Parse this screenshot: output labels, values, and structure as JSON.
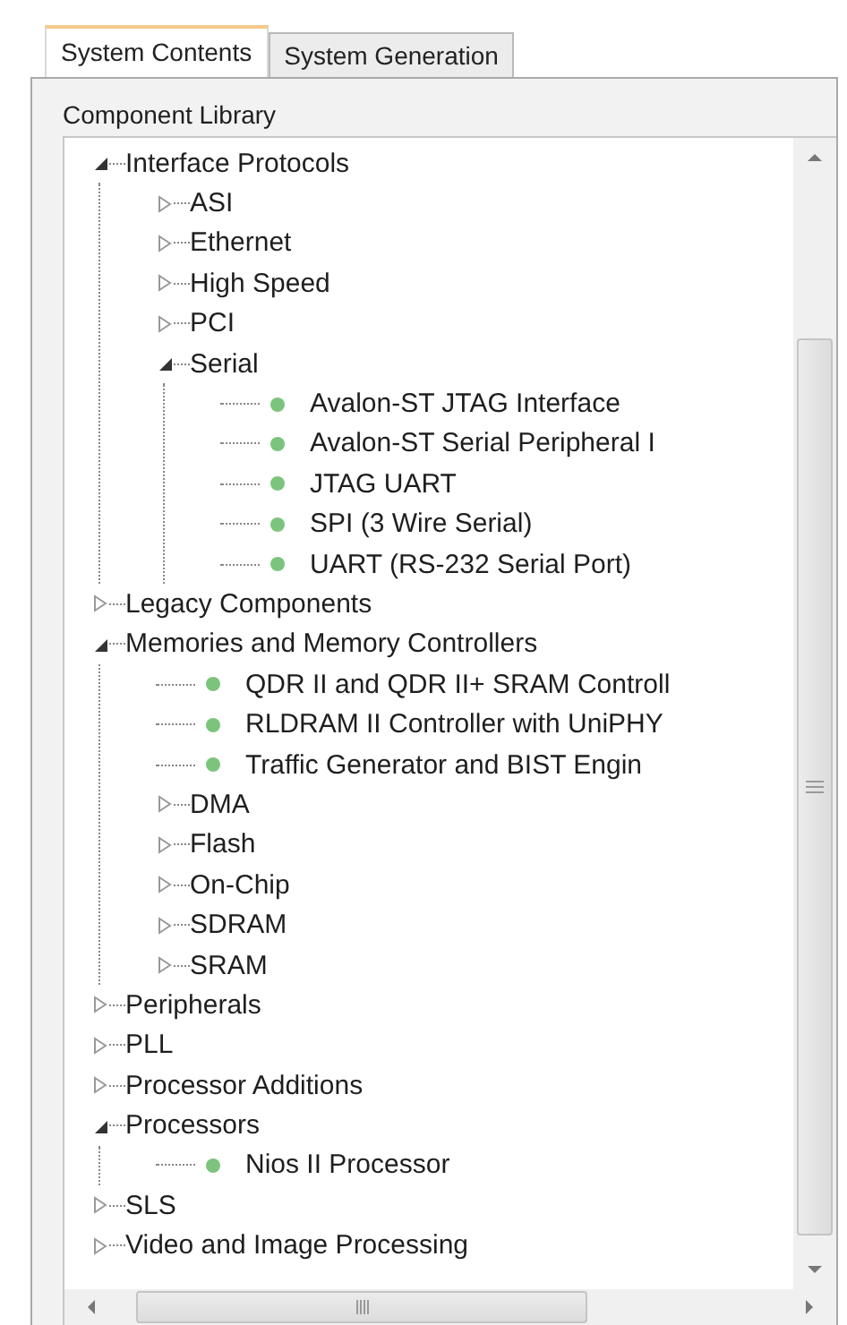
{
  "tabs": [
    {
      "label": "System Contents",
      "selected": true
    },
    {
      "label": "System Generation",
      "selected": false
    }
  ],
  "panel": {
    "title": "Component Library"
  },
  "tree": [
    {
      "kind": "folder",
      "label": "Interface Protocols",
      "expanded": true,
      "children": [
        {
          "kind": "folder",
          "label": "ASI",
          "expanded": false
        },
        {
          "kind": "folder",
          "label": "Ethernet",
          "expanded": false
        },
        {
          "kind": "folder",
          "label": "High Speed",
          "expanded": false
        },
        {
          "kind": "folder",
          "label": "PCI",
          "expanded": false
        },
        {
          "kind": "folder",
          "label": "Serial",
          "expanded": true,
          "children": [
            {
              "kind": "component",
              "label": "Avalon-ST JTAG Interface"
            },
            {
              "kind": "component",
              "label": "Avalon-ST Serial Peripheral I"
            },
            {
              "kind": "component",
              "label": "JTAG UART"
            },
            {
              "kind": "component",
              "label": "SPI (3 Wire Serial)"
            },
            {
              "kind": "component",
              "label": "UART (RS-232 Serial Port)"
            }
          ]
        }
      ]
    },
    {
      "kind": "folder",
      "label": "Legacy Components",
      "expanded": false
    },
    {
      "kind": "folder",
      "label": "Memories and Memory Controllers",
      "expanded": true,
      "children": [
        {
          "kind": "component",
          "label": "QDR II and QDR II+ SRAM Controll"
        },
        {
          "kind": "component",
          "label": "RLDRAM II Controller with UniPHY"
        },
        {
          "kind": "component",
          "label": "Traffic Generator and BIST Engin"
        },
        {
          "kind": "folder",
          "label": "DMA",
          "expanded": false
        },
        {
          "kind": "folder",
          "label": "Flash",
          "expanded": false
        },
        {
          "kind": "folder",
          "label": "On-Chip",
          "expanded": false
        },
        {
          "kind": "folder",
          "label": "SDRAM",
          "expanded": false
        },
        {
          "kind": "folder",
          "label": "SRAM",
          "expanded": false
        }
      ]
    },
    {
      "kind": "folder",
      "label": "Peripherals",
      "expanded": false
    },
    {
      "kind": "folder",
      "label": "PLL",
      "expanded": false
    },
    {
      "kind": "folder",
      "label": "Processor Additions",
      "expanded": false
    },
    {
      "kind": "folder",
      "label": "Processors",
      "expanded": true,
      "children": [
        {
          "kind": "component",
          "label": "Nios II Processor"
        }
      ]
    },
    {
      "kind": "folder",
      "label": "SLS",
      "expanded": false
    },
    {
      "kind": "folder",
      "label": "Video and Image Processing",
      "expanded": false
    }
  ]
}
